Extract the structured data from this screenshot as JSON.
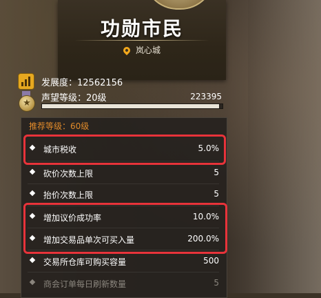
{
  "header": {
    "title": "功勋市民",
    "city": "岚心城"
  },
  "stats": {
    "development_label": "发展度：12562156",
    "reputation_label": "声望等级：20级",
    "reputation_points": "223395",
    "reputation_progress": 0.98
  },
  "panel": {
    "recommend_label": "推荐等级：60级",
    "rows": [
      {
        "label": "城市税收",
        "value": "5.0%"
      },
      {
        "label": "砍价次数上限",
        "value": "5"
      },
      {
        "label": "抬价次数上限",
        "value": "5"
      },
      {
        "label": "增加议价成功率",
        "value": "10.0%"
      },
      {
        "label": "增加交易品单次可买入量",
        "value": "200.0%"
      },
      {
        "label": "交易所仓库可购买容量",
        "value": "500"
      },
      {
        "label": "商会订单每日刷新数量",
        "value": "5"
      }
    ]
  },
  "colors": {
    "accent_orange": "#e08a2a",
    "highlight_red": "#e8333a",
    "pin": "#f3a81c"
  },
  "icons": {
    "location": "location-pin-icon",
    "development": "bar-chart-icon",
    "reputation": "medal-icon",
    "bullet": "diamond-bullet-icon"
  }
}
